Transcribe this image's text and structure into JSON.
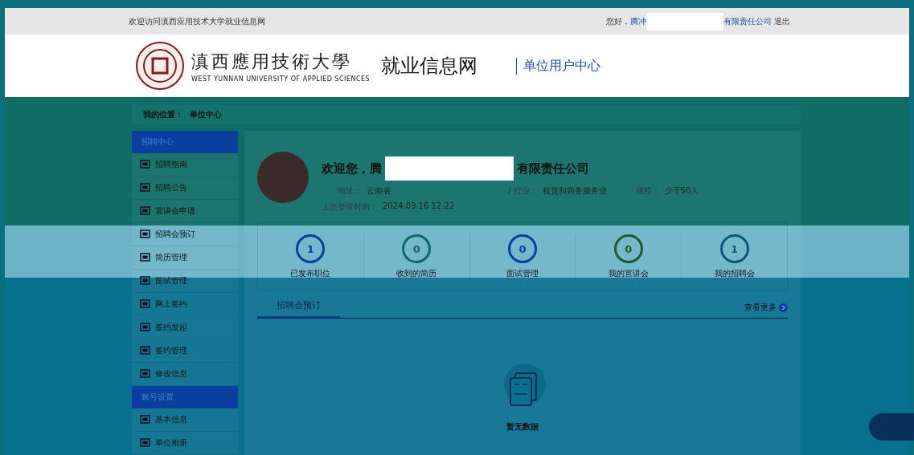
{
  "top_bar": {
    "welcome": "欢迎访问滇西应用技术大学就业信息网",
    "greeting": "您好，",
    "company_prefix": "腾冲",
    "company_suffix": "有限责任公司",
    "logout": "退出"
  },
  "header": {
    "logo_cn": "滇西應用技術大學",
    "logo_en": "WEST YUNNAN UNIVERSITY OF APPLIED SCIENCES",
    "site_name": "就业信息网",
    "center": "单位用户中心"
  },
  "breadcrumb": {
    "label": "我的位置：",
    "current": "单位中心"
  },
  "sidebar": [
    {
      "kind": "section",
      "label": "招聘中心"
    },
    {
      "kind": "item",
      "label": "招聘指南"
    },
    {
      "kind": "item",
      "label": "招聘公告"
    },
    {
      "kind": "item",
      "label": "宣讲会申请"
    },
    {
      "kind": "item",
      "label": "招聘会预订"
    },
    {
      "kind": "item",
      "label": "简历管理"
    },
    {
      "kind": "item",
      "label": "面试管理"
    },
    {
      "kind": "item",
      "label": "网上签约"
    },
    {
      "kind": "item",
      "label": "签约发起"
    },
    {
      "kind": "item",
      "label": "签约管理"
    },
    {
      "kind": "item",
      "label": "修改信息"
    },
    {
      "kind": "section",
      "label": "账号设置"
    },
    {
      "kind": "item",
      "label": "基本信息"
    },
    {
      "kind": "item",
      "label": "单位相册"
    }
  ],
  "profile": {
    "welcome_prefix": "欢迎您，腾",
    "welcome_suffix": "有限责任公司",
    "address_label": "地址：",
    "address": "云南省",
    "industry_label": "/ 行业：",
    "industry": "租赁和商务服务业",
    "scale_label": "规模：",
    "scale": "少于50人",
    "last_login_label": "上次登录时间：",
    "last_login": "2024.03.16 12:22"
  },
  "stats": [
    {
      "count": "1",
      "label": "已发布职位",
      "color": "#0a3fa0"
    },
    {
      "count": "0",
      "label": "收到的简历",
      "color": "#0d6a6a"
    },
    {
      "count": "0",
      "label": "面试管理",
      "color": "#0a3fa0"
    },
    {
      "count": "0",
      "label": "我的宣讲会",
      "color": "#1f5a2a"
    },
    {
      "count": "1",
      "label": "我的招聘会",
      "color": "#0d5a78"
    }
  ],
  "tabs": [
    {
      "label": "招聘会预订",
      "selected": true
    }
  ],
  "more_link": "查看更多",
  "empty_text": "暂无数据"
}
